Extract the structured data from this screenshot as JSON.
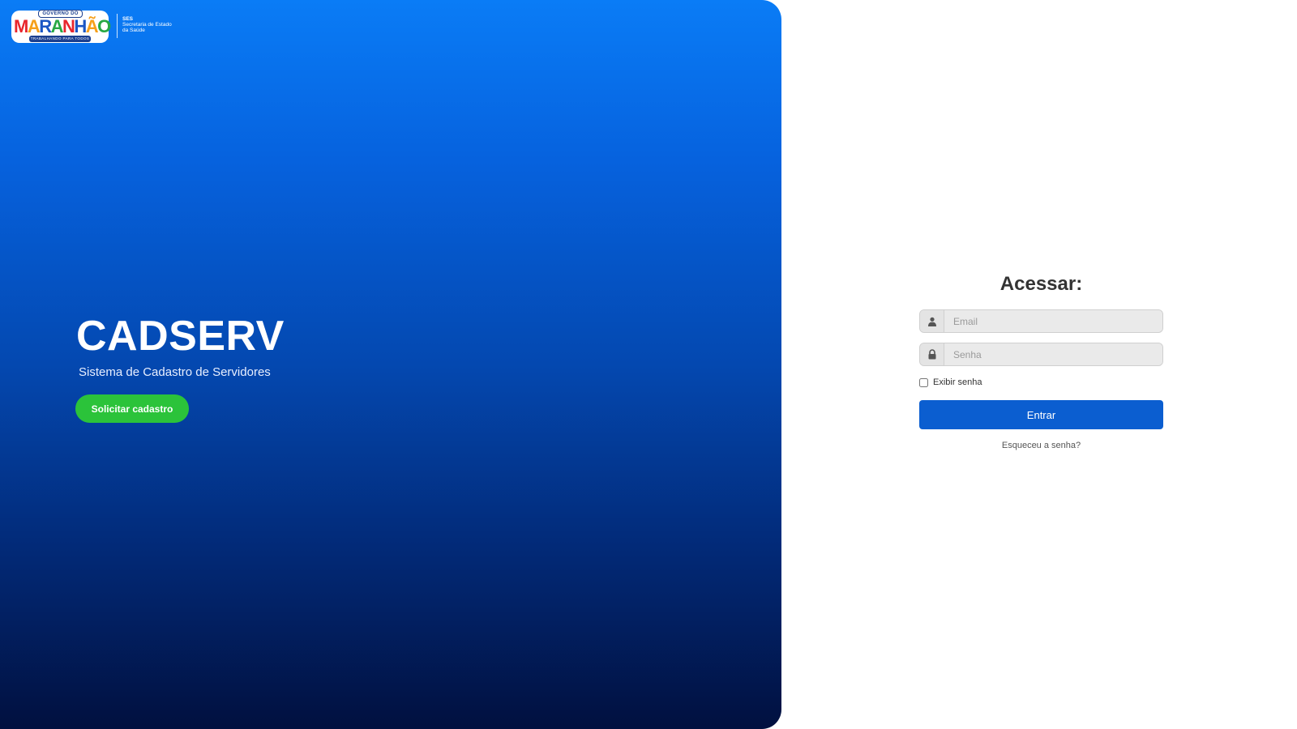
{
  "logo": {
    "top_text": "GOVERNO DO",
    "main_text": "MARANHÃO",
    "bottom_text": "TRABALHANDO PARA TODOS",
    "agency_acronym": "SES",
    "agency_name": "Secretaria de Estado da Saúde"
  },
  "hero": {
    "title": "CADSERV",
    "subtitle": "Sistema de Cadastro de Servidores",
    "signup_button": "Solicitar cadastro"
  },
  "login": {
    "title": "Acessar:",
    "email": {
      "placeholder": "Email",
      "value": "",
      "icon": "user-icon"
    },
    "password": {
      "placeholder": "Senha",
      "value": "",
      "icon": "lock-icon"
    },
    "show_password_label": "Exibir senha",
    "show_password_checked": false,
    "submit_button": "Entrar",
    "forgot_link": "Esqueceu a senha?"
  },
  "colors": {
    "gradient_top": "#0a7cf6",
    "gradient_bottom": "#01103f",
    "signup_green": "#2bc33a",
    "submit_blue": "#0b5ed0"
  }
}
